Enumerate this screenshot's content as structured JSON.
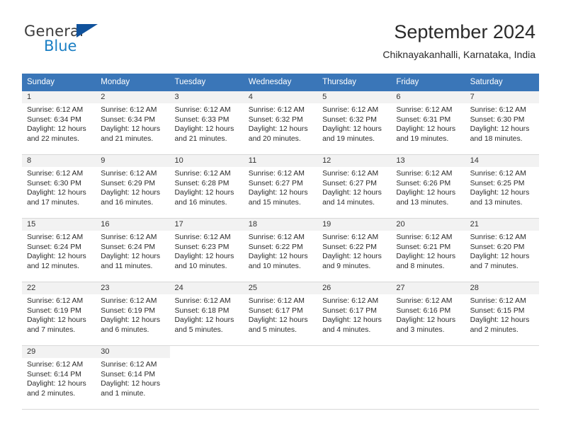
{
  "brand": {
    "name_part1": "General",
    "name_part2": "Blue",
    "flag_color": "#10529c",
    "blue_color": "#1b7fc4"
  },
  "header": {
    "title": "September 2024",
    "subtitle": "Chiknayakanhalli, Karnataka, India",
    "accent_color": "#3a76b8"
  },
  "calendar": {
    "weekdays": [
      "Sunday",
      "Monday",
      "Tuesday",
      "Wednesday",
      "Thursday",
      "Friday",
      "Saturday"
    ],
    "weeks": [
      [
        {
          "day": "1",
          "sunrise": "Sunrise: 6:12 AM",
          "sunset": "Sunset: 6:34 PM",
          "daylight1": "Daylight: 12 hours",
          "daylight2": "and 22 minutes."
        },
        {
          "day": "2",
          "sunrise": "Sunrise: 6:12 AM",
          "sunset": "Sunset: 6:34 PM",
          "daylight1": "Daylight: 12 hours",
          "daylight2": "and 21 minutes."
        },
        {
          "day": "3",
          "sunrise": "Sunrise: 6:12 AM",
          "sunset": "Sunset: 6:33 PM",
          "daylight1": "Daylight: 12 hours",
          "daylight2": "and 21 minutes."
        },
        {
          "day": "4",
          "sunrise": "Sunrise: 6:12 AM",
          "sunset": "Sunset: 6:32 PM",
          "daylight1": "Daylight: 12 hours",
          "daylight2": "and 20 minutes."
        },
        {
          "day": "5",
          "sunrise": "Sunrise: 6:12 AM",
          "sunset": "Sunset: 6:32 PM",
          "daylight1": "Daylight: 12 hours",
          "daylight2": "and 19 minutes."
        },
        {
          "day": "6",
          "sunrise": "Sunrise: 6:12 AM",
          "sunset": "Sunset: 6:31 PM",
          "daylight1": "Daylight: 12 hours",
          "daylight2": "and 19 minutes."
        },
        {
          "day": "7",
          "sunrise": "Sunrise: 6:12 AM",
          "sunset": "Sunset: 6:30 PM",
          "daylight1": "Daylight: 12 hours",
          "daylight2": "and 18 minutes."
        }
      ],
      [
        {
          "day": "8",
          "sunrise": "Sunrise: 6:12 AM",
          "sunset": "Sunset: 6:30 PM",
          "daylight1": "Daylight: 12 hours",
          "daylight2": "and 17 minutes."
        },
        {
          "day": "9",
          "sunrise": "Sunrise: 6:12 AM",
          "sunset": "Sunset: 6:29 PM",
          "daylight1": "Daylight: 12 hours",
          "daylight2": "and 16 minutes."
        },
        {
          "day": "10",
          "sunrise": "Sunrise: 6:12 AM",
          "sunset": "Sunset: 6:28 PM",
          "daylight1": "Daylight: 12 hours",
          "daylight2": "and 16 minutes."
        },
        {
          "day": "11",
          "sunrise": "Sunrise: 6:12 AM",
          "sunset": "Sunset: 6:27 PM",
          "daylight1": "Daylight: 12 hours",
          "daylight2": "and 15 minutes."
        },
        {
          "day": "12",
          "sunrise": "Sunrise: 6:12 AM",
          "sunset": "Sunset: 6:27 PM",
          "daylight1": "Daylight: 12 hours",
          "daylight2": "and 14 minutes."
        },
        {
          "day": "13",
          "sunrise": "Sunrise: 6:12 AM",
          "sunset": "Sunset: 6:26 PM",
          "daylight1": "Daylight: 12 hours",
          "daylight2": "and 13 minutes."
        },
        {
          "day": "14",
          "sunrise": "Sunrise: 6:12 AM",
          "sunset": "Sunset: 6:25 PM",
          "daylight1": "Daylight: 12 hours",
          "daylight2": "and 13 minutes."
        }
      ],
      [
        {
          "day": "15",
          "sunrise": "Sunrise: 6:12 AM",
          "sunset": "Sunset: 6:24 PM",
          "daylight1": "Daylight: 12 hours",
          "daylight2": "and 12 minutes."
        },
        {
          "day": "16",
          "sunrise": "Sunrise: 6:12 AM",
          "sunset": "Sunset: 6:24 PM",
          "daylight1": "Daylight: 12 hours",
          "daylight2": "and 11 minutes."
        },
        {
          "day": "17",
          "sunrise": "Sunrise: 6:12 AM",
          "sunset": "Sunset: 6:23 PM",
          "daylight1": "Daylight: 12 hours",
          "daylight2": "and 10 minutes."
        },
        {
          "day": "18",
          "sunrise": "Sunrise: 6:12 AM",
          "sunset": "Sunset: 6:22 PM",
          "daylight1": "Daylight: 12 hours",
          "daylight2": "and 10 minutes."
        },
        {
          "day": "19",
          "sunrise": "Sunrise: 6:12 AM",
          "sunset": "Sunset: 6:22 PM",
          "daylight1": "Daylight: 12 hours",
          "daylight2": "and 9 minutes."
        },
        {
          "day": "20",
          "sunrise": "Sunrise: 6:12 AM",
          "sunset": "Sunset: 6:21 PM",
          "daylight1": "Daylight: 12 hours",
          "daylight2": "and 8 minutes."
        },
        {
          "day": "21",
          "sunrise": "Sunrise: 6:12 AM",
          "sunset": "Sunset: 6:20 PM",
          "daylight1": "Daylight: 12 hours",
          "daylight2": "and 7 minutes."
        }
      ],
      [
        {
          "day": "22",
          "sunrise": "Sunrise: 6:12 AM",
          "sunset": "Sunset: 6:19 PM",
          "daylight1": "Daylight: 12 hours",
          "daylight2": "and 7 minutes."
        },
        {
          "day": "23",
          "sunrise": "Sunrise: 6:12 AM",
          "sunset": "Sunset: 6:19 PM",
          "daylight1": "Daylight: 12 hours",
          "daylight2": "and 6 minutes."
        },
        {
          "day": "24",
          "sunrise": "Sunrise: 6:12 AM",
          "sunset": "Sunset: 6:18 PM",
          "daylight1": "Daylight: 12 hours",
          "daylight2": "and 5 minutes."
        },
        {
          "day": "25",
          "sunrise": "Sunrise: 6:12 AM",
          "sunset": "Sunset: 6:17 PM",
          "daylight1": "Daylight: 12 hours",
          "daylight2": "and 5 minutes."
        },
        {
          "day": "26",
          "sunrise": "Sunrise: 6:12 AM",
          "sunset": "Sunset: 6:17 PM",
          "daylight1": "Daylight: 12 hours",
          "daylight2": "and 4 minutes."
        },
        {
          "day": "27",
          "sunrise": "Sunrise: 6:12 AM",
          "sunset": "Sunset: 6:16 PM",
          "daylight1": "Daylight: 12 hours",
          "daylight2": "and 3 minutes."
        },
        {
          "day": "28",
          "sunrise": "Sunrise: 6:12 AM",
          "sunset": "Sunset: 6:15 PM",
          "daylight1": "Daylight: 12 hours",
          "daylight2": "and 2 minutes."
        }
      ],
      [
        {
          "day": "29",
          "sunrise": "Sunrise: 6:12 AM",
          "sunset": "Sunset: 6:14 PM",
          "daylight1": "Daylight: 12 hours",
          "daylight2": "and 2 minutes."
        },
        {
          "day": "30",
          "sunrise": "Sunrise: 6:12 AM",
          "sunset": "Sunset: 6:14 PM",
          "daylight1": "Daylight: 12 hours",
          "daylight2": "and 1 minute."
        },
        {
          "day": "",
          "sunrise": "",
          "sunset": "",
          "daylight1": "",
          "daylight2": ""
        },
        {
          "day": "",
          "sunrise": "",
          "sunset": "",
          "daylight1": "",
          "daylight2": ""
        },
        {
          "day": "",
          "sunrise": "",
          "sunset": "",
          "daylight1": "",
          "daylight2": ""
        },
        {
          "day": "",
          "sunrise": "",
          "sunset": "",
          "daylight1": "",
          "daylight2": ""
        },
        {
          "day": "",
          "sunrise": "",
          "sunset": "",
          "daylight1": "",
          "daylight2": ""
        }
      ]
    ]
  }
}
